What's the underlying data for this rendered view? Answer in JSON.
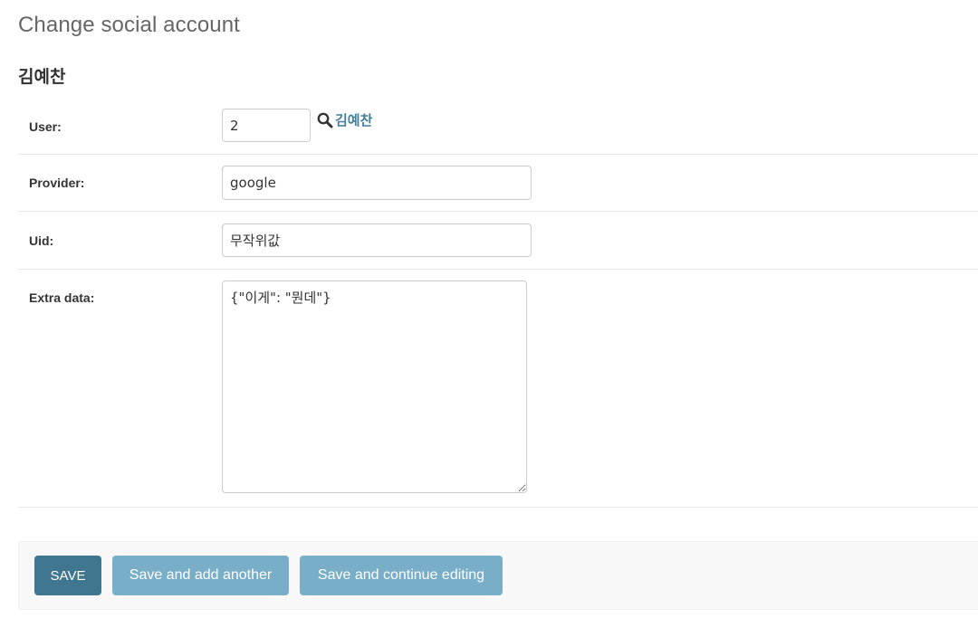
{
  "page_title": "Change social account",
  "object_name": "김예찬",
  "fields": {
    "user": {
      "label": "User:",
      "value": "2",
      "lookup_icon": "search-icon",
      "lookup_name": "김예찬"
    },
    "provider": {
      "label": "Provider:",
      "value": "google"
    },
    "uid": {
      "label": "Uid:",
      "value": "무작위값"
    },
    "extra_data": {
      "label": "Extra data:",
      "value": "{\"이게\": \"뭔데\"}"
    }
  },
  "buttons": {
    "save": "SAVE",
    "save_add_another": "Save and add another",
    "save_continue": "Save and continue editing"
  },
  "colors": {
    "primary_button": "#417690",
    "secondary_button": "#79aec8",
    "link": "#447e9b"
  }
}
